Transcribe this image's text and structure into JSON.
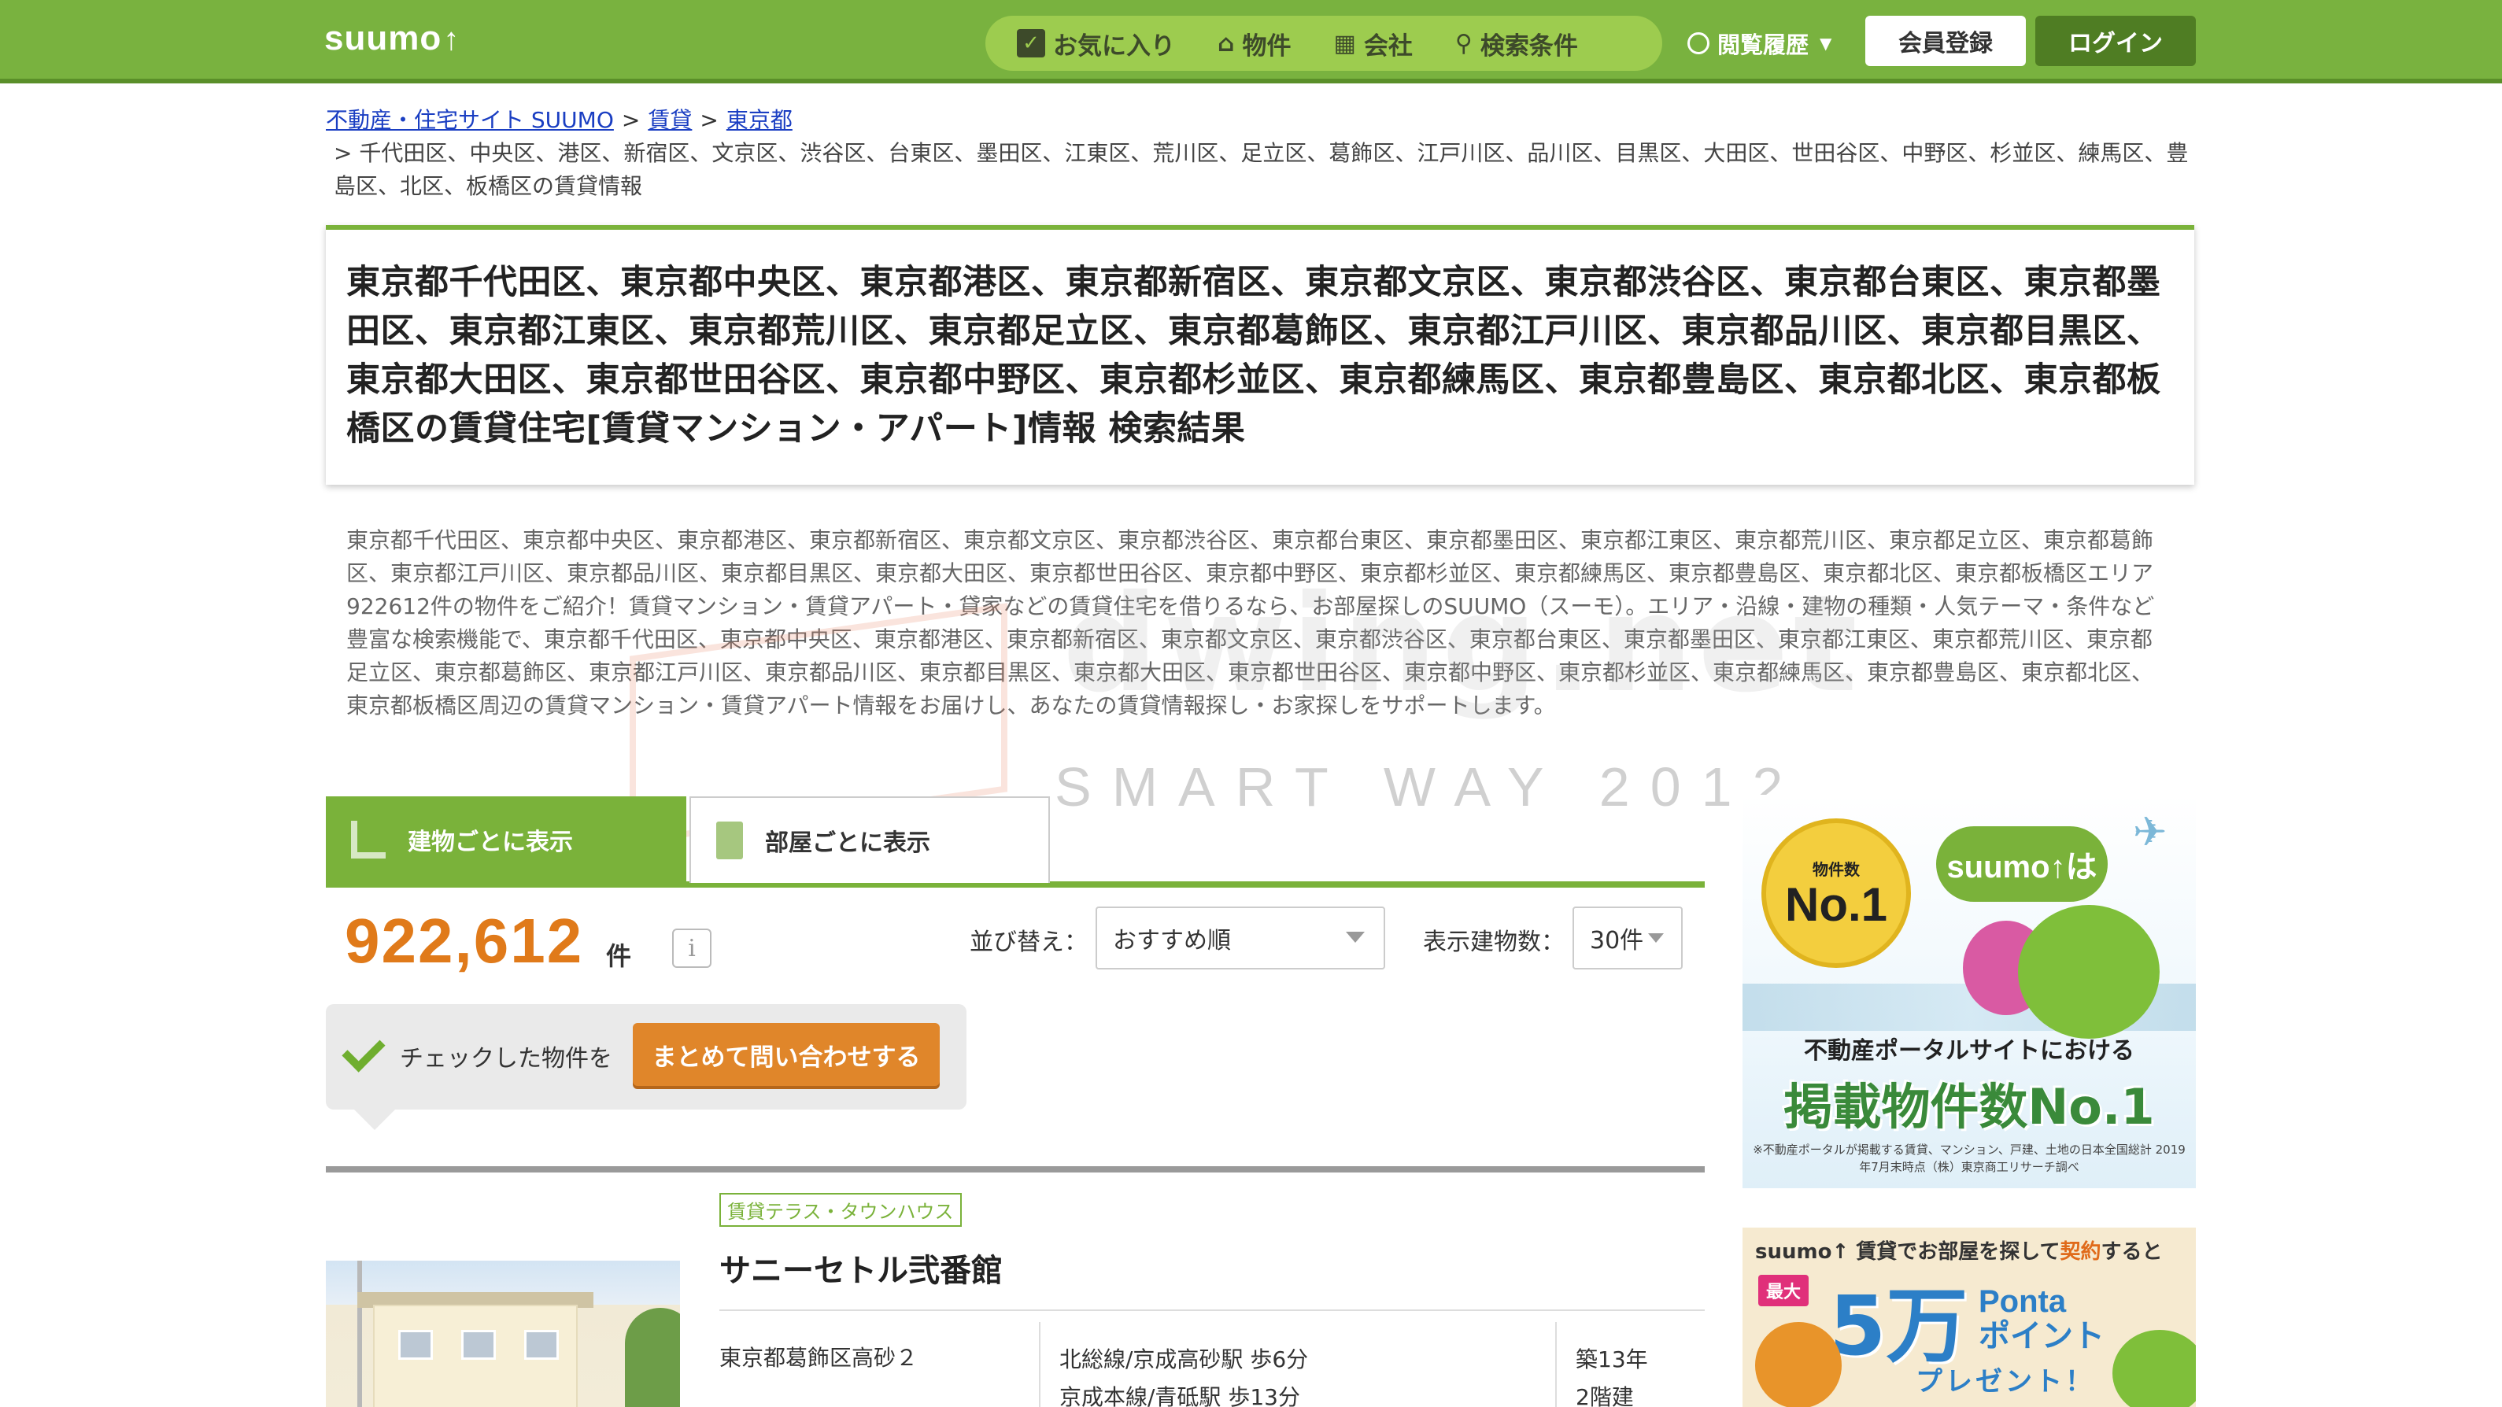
{
  "header": {
    "logo": "suumo",
    "nav": [
      {
        "label": "お気に入り",
        "icon": "heart-check-icon"
      },
      {
        "label": "物件",
        "icon": "home-icon"
      },
      {
        "label": "会社",
        "icon": "building-icon"
      },
      {
        "label": "検索条件",
        "icon": "search-icon"
      }
    ],
    "history_label": "閲覧履歴",
    "register_label": "会員登録",
    "login_label": "ログイン"
  },
  "breadcrumb": {
    "items": [
      "不動産・住宅サイト SUUMO",
      "賃貸",
      "東京都"
    ],
    "separator": ">",
    "rest": "> 千代田区、中央区、港区、新宿区、文京区、渋谷区、台東区、墨田区、江東区、荒川区、足立区、葛飾区、江戸川区、品川区、目黒区、大田区、世田谷区、中野区、杉並区、練馬区、豊島区、北区、板橋区の賃貸情報"
  },
  "title": "東京都千代田区、東京都中央区、東京都港区、東京都新宿区、東京都文京区、東京都渋谷区、東京都台東区、東京都墨田区、東京都江東区、東京都荒川区、東京都足立区、東京都葛飾区、東京都江戸川区、東京都品川区、東京都目黒区、東京都大田区、東京都世田谷区、東京都中野区、東京都杉並区、東京都練馬区、東京都豊島区、東京都北区、東京都板橋区の賃貸住宅[賃貸マンション・アパート]情報 検索結果",
  "description": "東京都千代田区、東京都中央区、東京都港区、東京都新宿区、東京都文京区、東京都渋谷区、東京都台東区、東京都墨田区、東京都江東区、東京都荒川区、東京都足立区、東京都葛飾区、東京都江戸川区、東京都品川区、東京都目黒区、東京都大田区、東京都世田谷区、東京都中野区、東京都杉並区、東京都練馬区、東京都豊島区、東京都北区、東京都板橋区エリア922612件の物件をご紹介！賃貸マンション・賃貸アパート・貸家などの賃貸住宅を借りるなら、お部屋探しのSUUMO（スーモ）。エリア・沿線・建物の種類・人気テーマ・条件など豊富な検索機能で、東京都千代田区、東京都中央区、東京都港区、東京都新宿区、東京都文京区、東京都渋谷区、東京都台東区、東京都墨田区、東京都江東区、東京都荒川区、東京都足立区、東京都葛飾区、東京都江戸川区、東京都品川区、東京都目黒区、東京都大田区、東京都世田谷区、東京都中野区、東京都杉並区、東京都練馬区、東京都豊島区、東京都北区、東京都板橋区周辺の賃貸マンション・賃貸アパート情報をお届けし、あなたの賃貸情報探し・お家探しをサポートします。",
  "watermark": {
    "text": "dwing.net",
    "sub": "SMART WAY 2012"
  },
  "tabs": {
    "building": "建物ごとに表示",
    "room": "部屋ごとに表示"
  },
  "results": {
    "count": "922,612",
    "unit": "件",
    "info": "i",
    "sort_label": "並び替え：",
    "sort_value": "おすすめ順",
    "per_label": "表示建物数：",
    "per_value": "30件"
  },
  "check": {
    "text": "チェックした物件を",
    "button": "まとめて問い合わせする"
  },
  "listing": {
    "type": "賃貸テラス・タウンハウス",
    "name": "サニーセトル弐番館",
    "address": "東京都葛飾区高砂２",
    "station1": "北総線/京成高砂駅 歩6分",
    "station2": "京成本線/青砥駅 歩13分",
    "age": "築13年",
    "floors": "2階建"
  },
  "ad1": {
    "badge_small": "物件数",
    "badge_big": "No.1",
    "bubble": "suumo↑は",
    "line1": "不動産ポータルサイトにおける",
    "line2": "掲載物件数No.1",
    "note": "※不動産ポータルが掲載する賃貸、マンション、戸建、土地の日本全国総計 2019年7月末時点（株）東京商工リサーチ調べ"
  },
  "ad2": {
    "top_a": "suumo↑ 賃貸でお部屋を探して",
    "top_hl": "契約",
    "top_b": "すると",
    "max": "最大",
    "amount": "5万",
    "ponta_a": "Ponta",
    "ponta_b": "ポイント",
    "present": "プレゼント！"
  },
  "colors": {
    "brand_green": "#79b23f",
    "count_orange": "#e07a1a",
    "link_blue": "#1a3ec2"
  }
}
